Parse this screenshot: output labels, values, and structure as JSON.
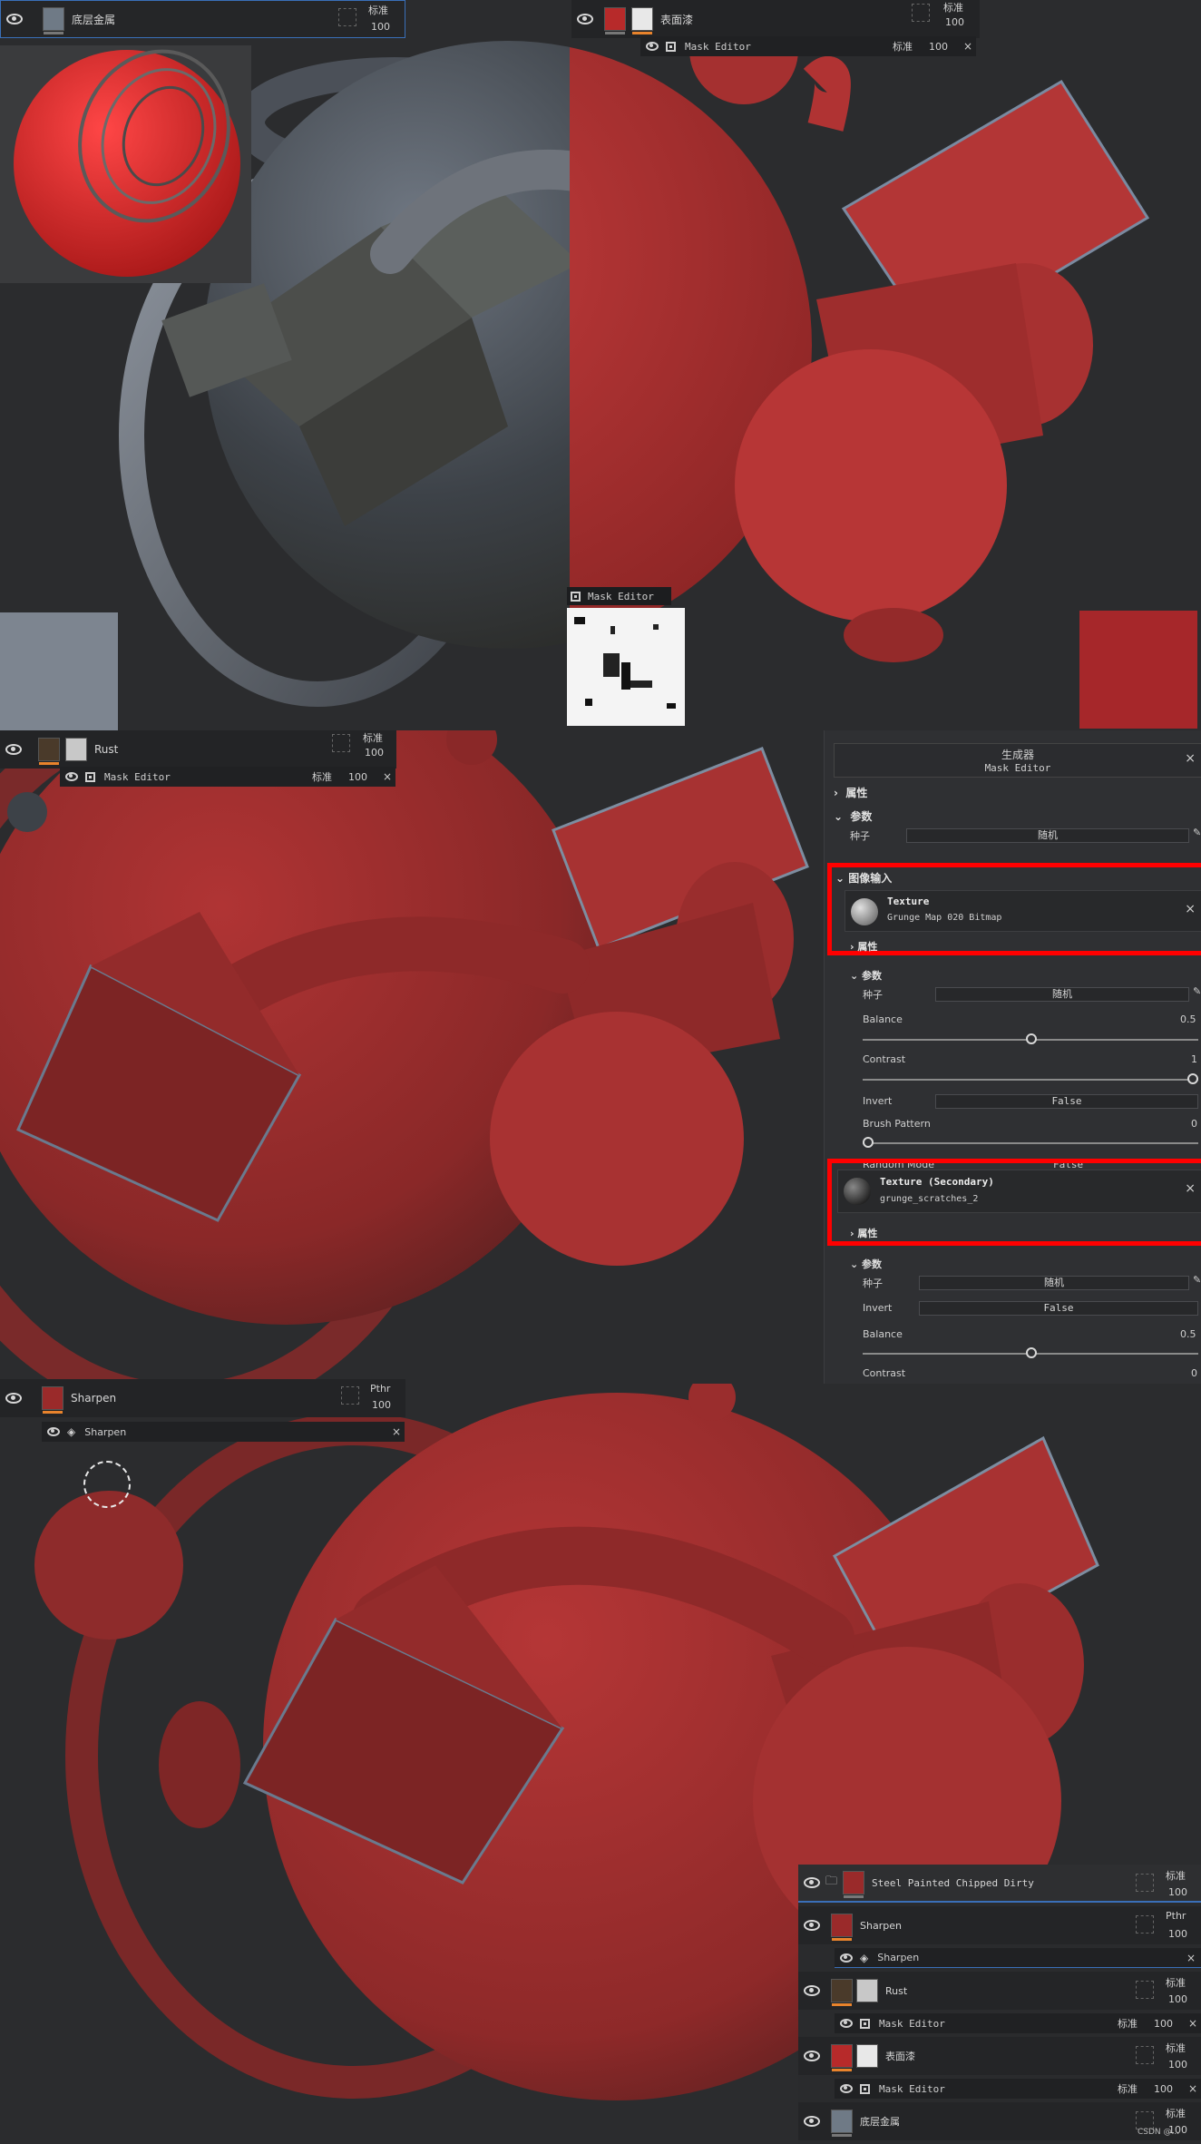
{
  "top_left_layer": {
    "name": "底层金属",
    "blend": "标准",
    "opacity": "100"
  },
  "top_right_layer": {
    "name": "表面漆",
    "blend": "标准",
    "opacity": "100"
  },
  "top_right_mask": {
    "label": "Mask Editor",
    "blend": "标准",
    "opacity": "100"
  },
  "mask_preview": {
    "label": "Mask Editor"
  },
  "rust_layer": {
    "name": "Rust",
    "blend": "标准",
    "opacity": "100"
  },
  "rust_mask": {
    "label": "Mask Editor",
    "blend": "标准",
    "opacity": "100"
  },
  "panel": {
    "title": "生成器",
    "subtitle": "Mask Editor",
    "attributes": "属性",
    "params": "参数",
    "seed_label": "种子",
    "seed_value": "随机",
    "image_input": "图像输入",
    "texture1": {
      "title": "Texture",
      "file": "Grunge Map 020 Bitmap"
    },
    "attr2": "属性",
    "params2": "参数",
    "seed2_label": "种子",
    "seed2_value": "随机",
    "balance_label": "Balance",
    "balance_value": "0.5",
    "contrast_label": "Contrast",
    "contrast_value": "1",
    "invert_label": "Invert",
    "invert_value": "False",
    "brush_label": "Brush Pattern",
    "brush_value": "0",
    "random_label": "Random Mode",
    "random_value": "False",
    "texture2": {
      "title": "Texture (Secondary)",
      "file": "grunge_scratches_2"
    },
    "attr3": "属性",
    "params3": "参数",
    "seed3_label": "种子",
    "seed3_value": "随机",
    "invert3_label": "Invert",
    "invert3_value": "False",
    "balance3_label": "Balance",
    "balance3_value": "0.5",
    "contrast3_label": "Contrast",
    "contrast3_value": "0"
  },
  "sharpen_layer": {
    "name": "Sharpen",
    "blend": "Pthr",
    "opacity": "100"
  },
  "sharpen_effect": {
    "label": "Sharpen"
  },
  "stack": {
    "folder": {
      "name": "Steel Painted Chipped Dirty",
      "blend": "标准",
      "opacity": "100"
    },
    "sharpen": {
      "name": "Sharpen",
      "blend": "Pthr",
      "opacity": "100"
    },
    "sharpen_fx": {
      "label": "Sharpen"
    },
    "rust": {
      "name": "Rust",
      "blend": "标准",
      "opacity": "100"
    },
    "rust_mask": {
      "label": "Mask Editor",
      "blend": "标准",
      "opacity": "100"
    },
    "paint": {
      "name": "表面漆",
      "blend": "标准",
      "opacity": "100"
    },
    "paint_mask": {
      "label": "Mask Editor",
      "blend": "标准",
      "opacity": "100"
    },
    "metal": {
      "name": "底层金属",
      "blend": "标准",
      "opacity": "100"
    }
  },
  "watermark": "CSDN @..."
}
